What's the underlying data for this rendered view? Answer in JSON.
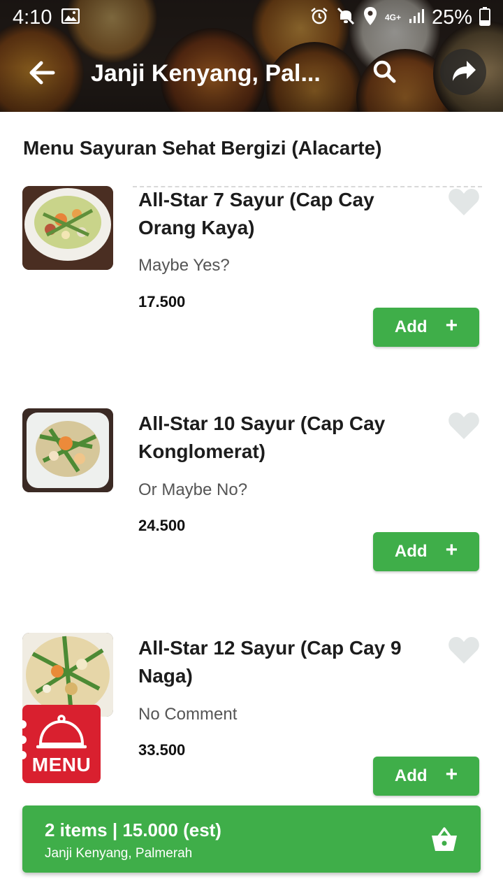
{
  "status_bar": {
    "time": "4:10",
    "network": "4G+",
    "battery": "25%"
  },
  "app_bar": {
    "title": "Janji Kenyang, Pal..."
  },
  "section": {
    "title": "Menu Sayuran Sehat Bergizi (Alacarte)"
  },
  "items": [
    {
      "name": "All-Star 7 Sayur (Cap Cay Orang Kaya)",
      "description": "Maybe Yes?",
      "price": "17.500",
      "add_label": "Add"
    },
    {
      "name": "All-Star 10 Sayur (Cap Cay Konglomerat)",
      "description": "Or Maybe No?",
      "price": "24.500",
      "add_label": "Add"
    },
    {
      "name": "All-Star 12 Sayur (Cap Cay 9 Naga)",
      "description": "No Comment",
      "price": "33.500",
      "add_label": "Add"
    }
  ],
  "menu_button": {
    "label": "MENU"
  },
  "cart": {
    "summary": "2 items | 15.000 (est)",
    "restaurant": "Janji Kenyang, Palmerah"
  },
  "colors": {
    "accent_green": "#3fae49",
    "menu_red": "#d9202f",
    "favorite_gray": "#e2e6e6"
  },
  "icons": [
    "gallery-icon",
    "alarm-icon",
    "mute-icon",
    "location-icon",
    "signal-icon",
    "battery-icon",
    "back-arrow-icon",
    "search-icon",
    "share-icon",
    "heart-icon",
    "plus-icon",
    "cloche-icon",
    "basket-icon"
  ]
}
